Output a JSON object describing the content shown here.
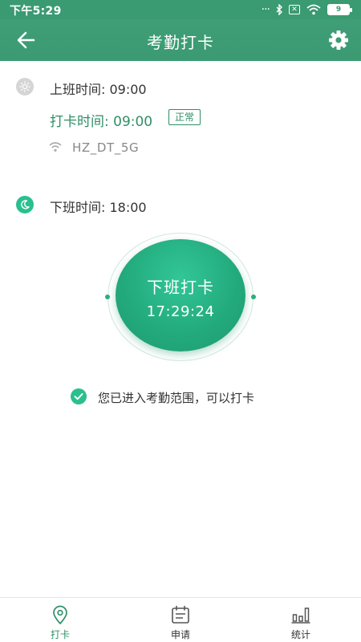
{
  "status_bar": {
    "time": "下午5:29",
    "dots": "···",
    "battery": "9"
  },
  "header": {
    "title": "考勤打卡"
  },
  "on_duty": {
    "label": "上班时间: 09:00"
  },
  "clock_in": {
    "label": "打卡时间: 09:00",
    "status": "正常"
  },
  "wifi": {
    "name": "HZ_DT_5G"
  },
  "off_duty": {
    "label": "下班时间: 18:00"
  },
  "punch_button": {
    "label": "下班打卡",
    "time": "17:29:24"
  },
  "range_message": "您已进入考勤范围，可以打卡",
  "bottom_nav": [
    {
      "label": "打卡",
      "icon": "location-pin-icon",
      "active": true
    },
    {
      "label": "申请",
      "icon": "calendar-icon",
      "active": false
    },
    {
      "label": "统计",
      "icon": "bar-chart-icon",
      "active": false
    }
  ],
  "colors": {
    "primary": "#3a9a72",
    "accent": "#2bbf8f",
    "text_green": "#2f8f66"
  }
}
